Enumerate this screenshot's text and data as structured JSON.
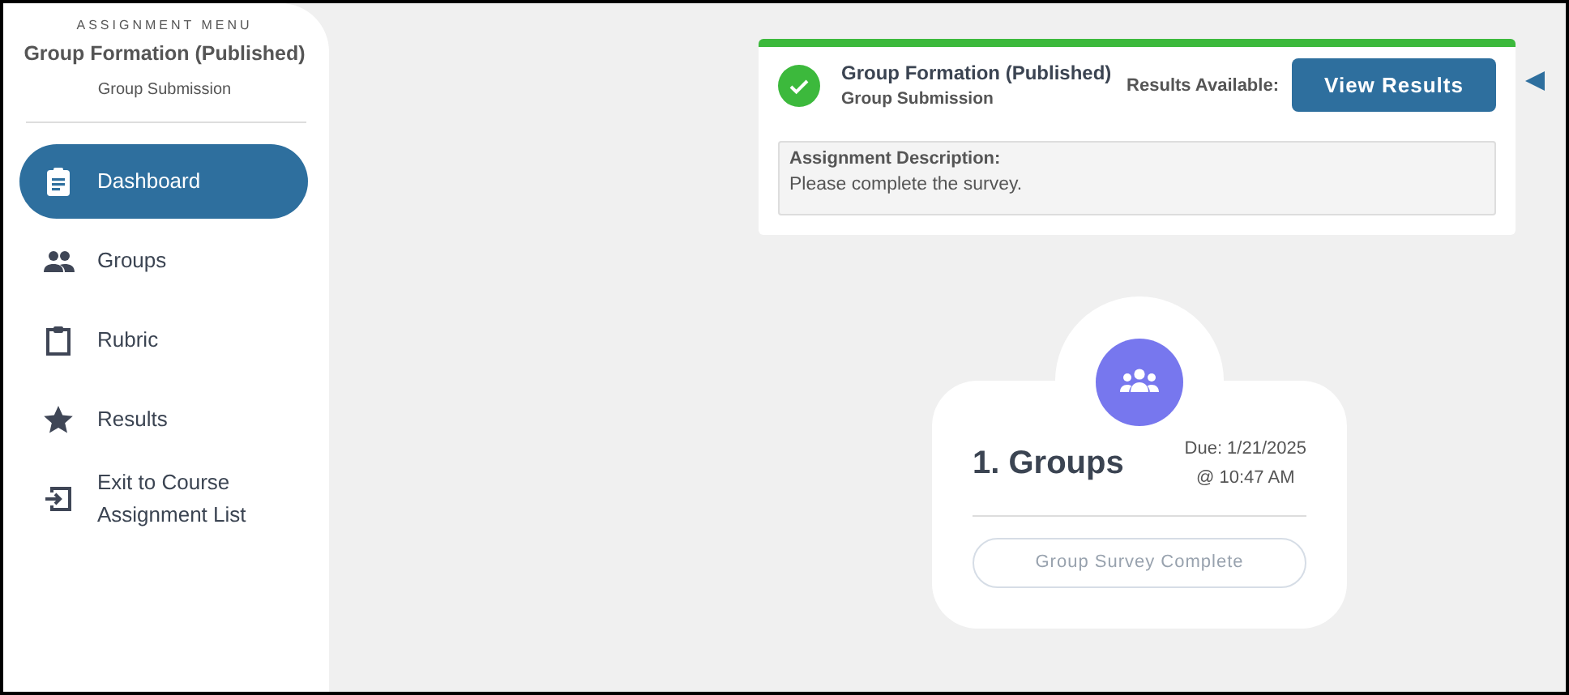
{
  "sidebar": {
    "menu_label": "ASSIGNMENT MENU",
    "title": "Group Formation (Published)",
    "subtitle": "Group Submission",
    "items": [
      {
        "label": "Dashboard",
        "selected": true
      },
      {
        "label": "Groups",
        "selected": false
      },
      {
        "label": "Rubric",
        "selected": false
      },
      {
        "label": "Results",
        "selected": false
      },
      {
        "label": "Exit to Course Assignment List",
        "selected": false
      }
    ]
  },
  "assignment_card": {
    "title": "Group Formation (Published)",
    "subtitle": "Group Submission",
    "results_label": "Results Available:",
    "button": "View Results",
    "description_label": "Assignment Description:",
    "description": "Please complete the survey."
  },
  "steps": [
    {
      "title": "1. Groups",
      "due": "Due: 1/21/2025",
      "due_time": "@ 10:47 AM",
      "button": "Group Survey Complete",
      "disabled": true
    }
  ]
}
